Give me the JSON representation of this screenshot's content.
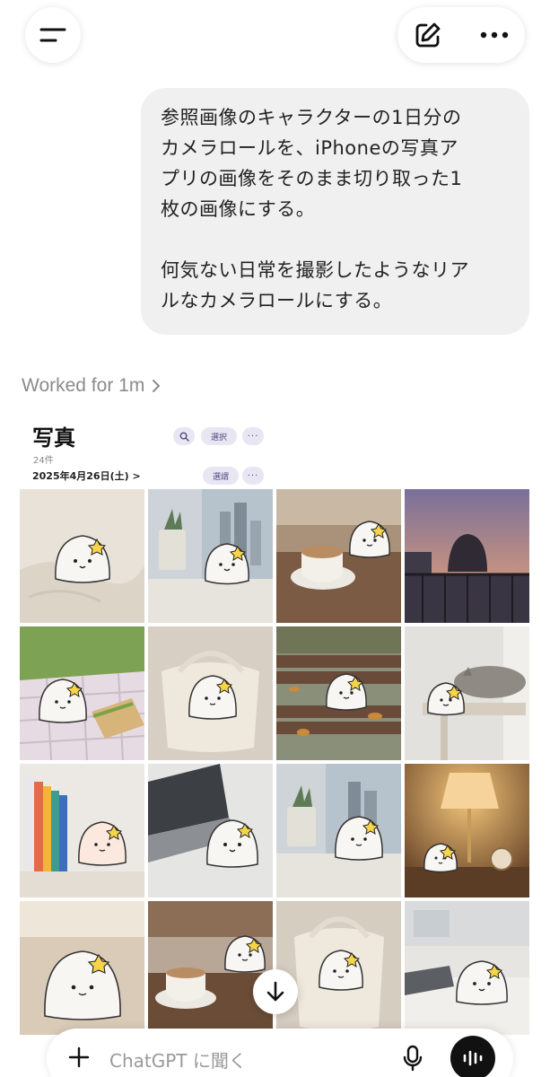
{
  "header": {
    "menu_icon": "menu-icon",
    "edit_icon": "compose-icon",
    "more_icon": "more-icon"
  },
  "message": {
    "line1": "参照画像のキャラクターの1日分の",
    "line2": "カメラロールを、iPhoneの写真ア",
    "line3": "プリの画像をそのまま切り取った1",
    "line4": "枚の画像にする。",
    "line5": "何気ない日常を撮影したようなリア",
    "line6": "ルなカメラロールにする。"
  },
  "status": {
    "worked": "Worked for 1m"
  },
  "photos_app": {
    "title": "写真",
    "count": "24件",
    "date": "2025年4月26日(土) >",
    "select_label": "選択",
    "select_label_2": "選謂",
    "more_label": "···"
  },
  "input": {
    "placeholder": "ChatGPT に聞く"
  },
  "colors": {
    "bubble_bg": "#f0f0f1",
    "accent_pill": "#e8e6f3",
    "voice_button": "#111111"
  }
}
